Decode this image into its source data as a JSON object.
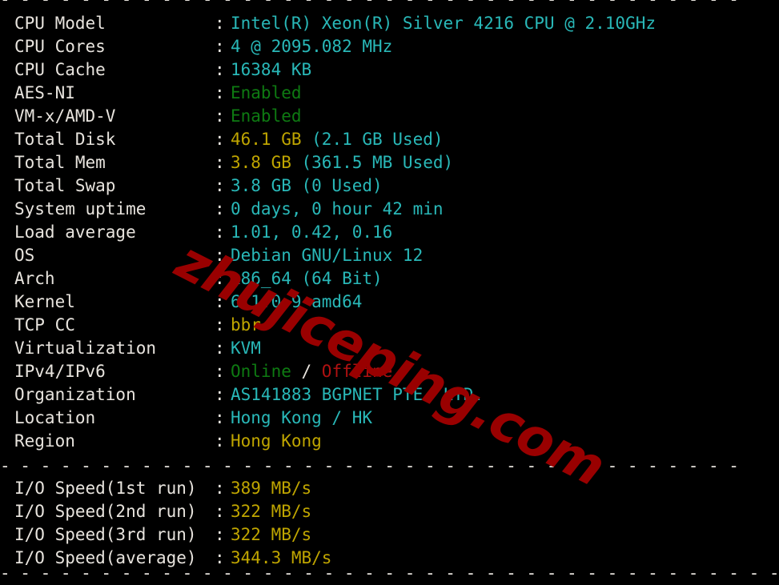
{
  "terminal": {
    "background": "#000000",
    "foreground": "#e8e4de",
    "colors": {
      "cyan": "#29b8b8",
      "green": "#0e7a12",
      "yellow": "#bfa500",
      "red": "#b01111",
      "white": "#e8e4de",
      "watermark_red": "#990000"
    },
    "separator_top": "- - - - - - - - - - - - - - - - - - - - - - - - - - - - - - - - - - - - - - - - - - - - - - - - -",
    "separator_middle": "- - - - - - - - - - - - - - - - - - - - - - - - - - - - - - - - - - - - - - - - - - - - - - - - -",
    "separator_bottom": "- - - - - - - - - - - - - - - - - - - - - - - - - - - - - - - - - - - - - - - - - - - - - - - - - - -",
    "colon": ":"
  },
  "watermark": {
    "text": "zhujiceping.com"
  },
  "system_info": [
    {
      "label": "CPU Model",
      "value": "Intel(R) Xeon(R) Silver 4216 CPU @ 2.10GHz",
      "color": "cyan"
    },
    {
      "label": "CPU Cores",
      "value": "4 @ 2095.082 MHz",
      "color": "cyan"
    },
    {
      "label": "CPU Cache",
      "value": "16384 KB",
      "color": "cyan"
    },
    {
      "label": "AES-NI",
      "value": "Enabled",
      "color": "green"
    },
    {
      "label": "VM-x/AMD-V",
      "value": "Enabled",
      "color": "green"
    },
    {
      "label": "Total Disk",
      "value": "46.1 GB (2.1 GB Used)",
      "color": "split",
      "parts": [
        {
          "text": "46.1 GB",
          "color": "yellow"
        },
        {
          "text": " (2.1 GB Used)",
          "color": "cyan"
        }
      ]
    },
    {
      "label": "Total Mem",
      "value": "3.8 GB (361.5 MB Used)",
      "color": "split",
      "parts": [
        {
          "text": "3.8 GB",
          "color": "yellow"
        },
        {
          "text": " (361.5 MB Used)",
          "color": "cyan"
        }
      ]
    },
    {
      "label": "Total Swap",
      "value": "3.8 GB (0 Used)",
      "color": "cyan"
    },
    {
      "label": "System uptime",
      "value": "0 days, 0 hour 42 min",
      "color": "cyan"
    },
    {
      "label": "Load average",
      "value": "1.01, 0.42, 0.16",
      "color": "cyan"
    },
    {
      "label": "OS",
      "value": "Debian GNU/Linux 12",
      "color": "cyan"
    },
    {
      "label": "Arch",
      "value": "x86_64 (64 Bit)",
      "color": "cyan"
    },
    {
      "label": "Kernel",
      "value": "6.1.0-9-amd64",
      "color": "cyan"
    },
    {
      "label": "TCP CC",
      "value": "bbr",
      "color": "yellow"
    },
    {
      "label": "Virtualization",
      "value": "KVM",
      "color": "cyan"
    },
    {
      "label": "IPv4/IPv6",
      "value": "Online / Offline",
      "color": "split",
      "parts": [
        {
          "text": "Online",
          "color": "green"
        },
        {
          "text": " / ",
          "color": "white"
        },
        {
          "text": "Offline",
          "color": "red"
        }
      ]
    },
    {
      "label": "Organization",
      "value": "AS141883 BGPNET PTE. LTD.",
      "color": "cyan"
    },
    {
      "label": "Location",
      "value": "Hong Kong / HK",
      "color": "cyan"
    },
    {
      "label": "Region",
      "value": "Hong Kong",
      "color": "yellow"
    }
  ],
  "io_speed": [
    {
      "label": "I/O Speed(1st run)",
      "value": "389 MB/s",
      "color": "yellow"
    },
    {
      "label": "I/O Speed(2nd run)",
      "value": "322 MB/s",
      "color": "yellow"
    },
    {
      "label": "I/O Speed(3rd run)",
      "value": "322 MB/s",
      "color": "yellow"
    },
    {
      "label": "I/O Speed(average)",
      "value": "344.3 MB/s",
      "color": "yellow"
    }
  ]
}
